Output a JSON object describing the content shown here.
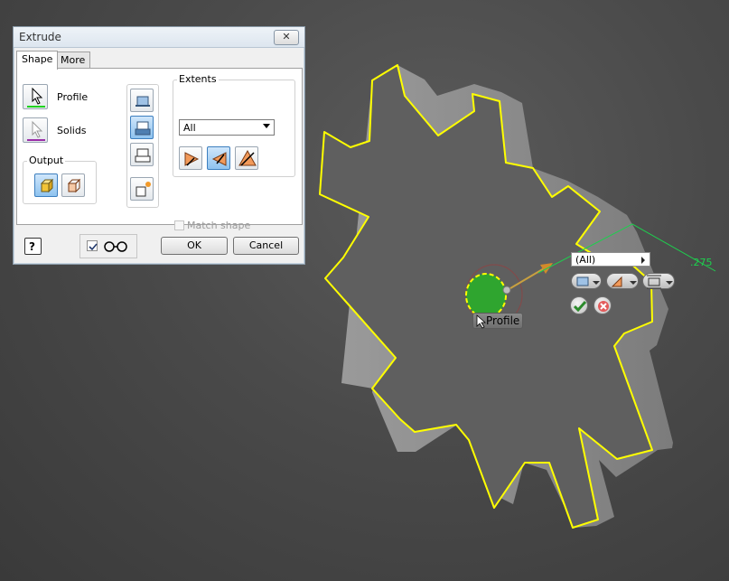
{
  "dialog": {
    "title": "Extrude",
    "close_label": "✕",
    "tabs": [
      {
        "label": "Shape",
        "active": true
      },
      {
        "label": "More",
        "active": false
      }
    ],
    "profile_label": "Profile",
    "solids_label": "Solids",
    "output": {
      "legend": "Output",
      "buttons": [
        {
          "name": "solid-output",
          "selected": true
        },
        {
          "name": "surface-output",
          "selected": false
        }
      ]
    },
    "operations": [
      {
        "name": "join",
        "selected": false
      },
      {
        "name": "cut",
        "selected": true
      },
      {
        "name": "intersect",
        "selected": false
      },
      {
        "name": "new-solid",
        "selected": false
      }
    ],
    "extents": {
      "legend": "Extents",
      "selected": "All",
      "directions": [
        {
          "name": "direction-1",
          "selected": false
        },
        {
          "name": "direction-2",
          "selected": true
        },
        {
          "name": "symmetric",
          "selected": false
        }
      ]
    },
    "match_shape": {
      "label": "Match shape",
      "checked": false,
      "enabled": false
    },
    "footer": {
      "help_label": "?",
      "preview_checked": true,
      "ok_label": "OK",
      "cancel_label": "Cancel"
    }
  },
  "viewport": {
    "mini_toolbar": {
      "selected": "(All)"
    },
    "profile_tag": "Profile",
    "dimension_value": ".275",
    "colors": {
      "gear_face": "#5f5f5f",
      "gear_side": "#8b8b8b",
      "highlight": "#ffff00",
      "profile": "#2fa52f",
      "dimension": "#1ecf4e"
    }
  }
}
